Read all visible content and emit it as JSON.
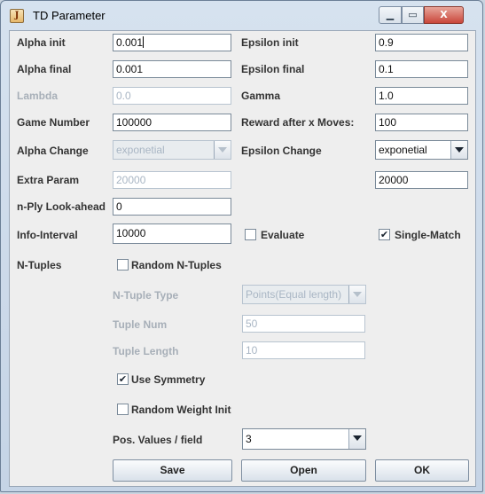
{
  "window": {
    "title": "TD Parameter",
    "app_icon_glyph": "J"
  },
  "window_buttons": {
    "minimize": "▁",
    "maximize": "▭",
    "close": "X"
  },
  "fields": {
    "alpha_init": {
      "label": "Alpha init",
      "value": "0.001"
    },
    "alpha_final": {
      "label": "Alpha final",
      "value": "0.001"
    },
    "lambda": {
      "label": "Lambda",
      "value": "0.0"
    },
    "game_number": {
      "label": "Game Number",
      "value": "100000"
    },
    "alpha_change": {
      "label": "Alpha Change",
      "value": "exponetial"
    },
    "extra_param": {
      "label": "Extra Param",
      "value": "20000"
    },
    "nply": {
      "label": "n-Ply Look-ahead",
      "value": "0"
    },
    "info_interval": {
      "label": "Info-Interval",
      "value": "10000"
    },
    "epsilon_init": {
      "label": "Epsilon init",
      "value": "0.9"
    },
    "epsilon_final": {
      "label": "Epsilon final",
      "value": "0.1"
    },
    "gamma": {
      "label": "Gamma",
      "value": "1.0"
    },
    "reward": {
      "label": "Reward after x Moves:",
      "value": "100"
    },
    "epsilon_change": {
      "label": "Epsilon Change",
      "value": "exponetial"
    },
    "epsilon_extra": {
      "value": "20000"
    }
  },
  "checks": {
    "evaluate": {
      "label": "Evaluate",
      "checked": false,
      "mark": ""
    },
    "single_match": {
      "label": "Single-Match",
      "checked": true,
      "mark": "✔"
    },
    "random_ntuples": {
      "label": "Random N-Tuples",
      "checked": false,
      "mark": ""
    },
    "use_symmetry": {
      "label": "Use Symmetry",
      "checked": true,
      "mark": "✔"
    },
    "random_weight_init": {
      "label": "Random Weight Init",
      "checked": false,
      "mark": ""
    }
  },
  "ntuples": {
    "label": "N-Tuples",
    "type_label": "N-Tuple Type",
    "type_value": "Points(Equal length)",
    "num_label": "Tuple Num",
    "num_value": "50",
    "length_label": "Tuple Length",
    "length_value": "10",
    "pos_values_label": "Pos. Values / field",
    "pos_values_value": "3"
  },
  "buttons": {
    "save": "Save",
    "open": "Open",
    "ok": "OK"
  },
  "colors": {
    "disabled_text": "#a9b6c4",
    "label_text": "#333333"
  }
}
